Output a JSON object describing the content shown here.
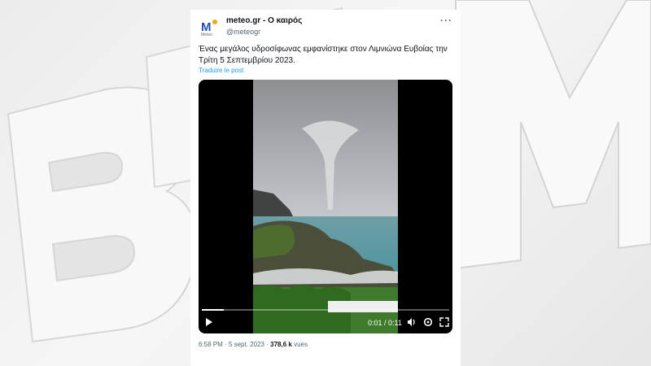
{
  "watermark": {
    "letters": [
      "B",
      "F",
      "M"
    ]
  },
  "tweet": {
    "avatar_letter": "M",
    "avatar_caption": "Meteo",
    "author_name": "meteo.gr - Ο καιρός",
    "author_handle": "@meteogr",
    "text": "Ένας μεγάλος υδροσίφωνας εμφανίστηκε στον Λιμνιώνα Ευβοίας την Τρίτη 5 Σεπτεμβρίου 2023.",
    "translate_label": "Traduire le post",
    "time": "6:58 PM",
    "date": "5 sept. 2023",
    "views_count": "378,6 k",
    "views_label": "vues"
  },
  "video": {
    "time_display": "0:01 / 0:11",
    "progress": 0.09,
    "icons": [
      "play-icon",
      "volume-icon",
      "settings-icon",
      "fullscreen-icon"
    ]
  },
  "colors": {
    "accent": "#1d9bf0",
    "brand_blue": "#1f4fa8",
    "brand_orange": "#f2a900"
  }
}
